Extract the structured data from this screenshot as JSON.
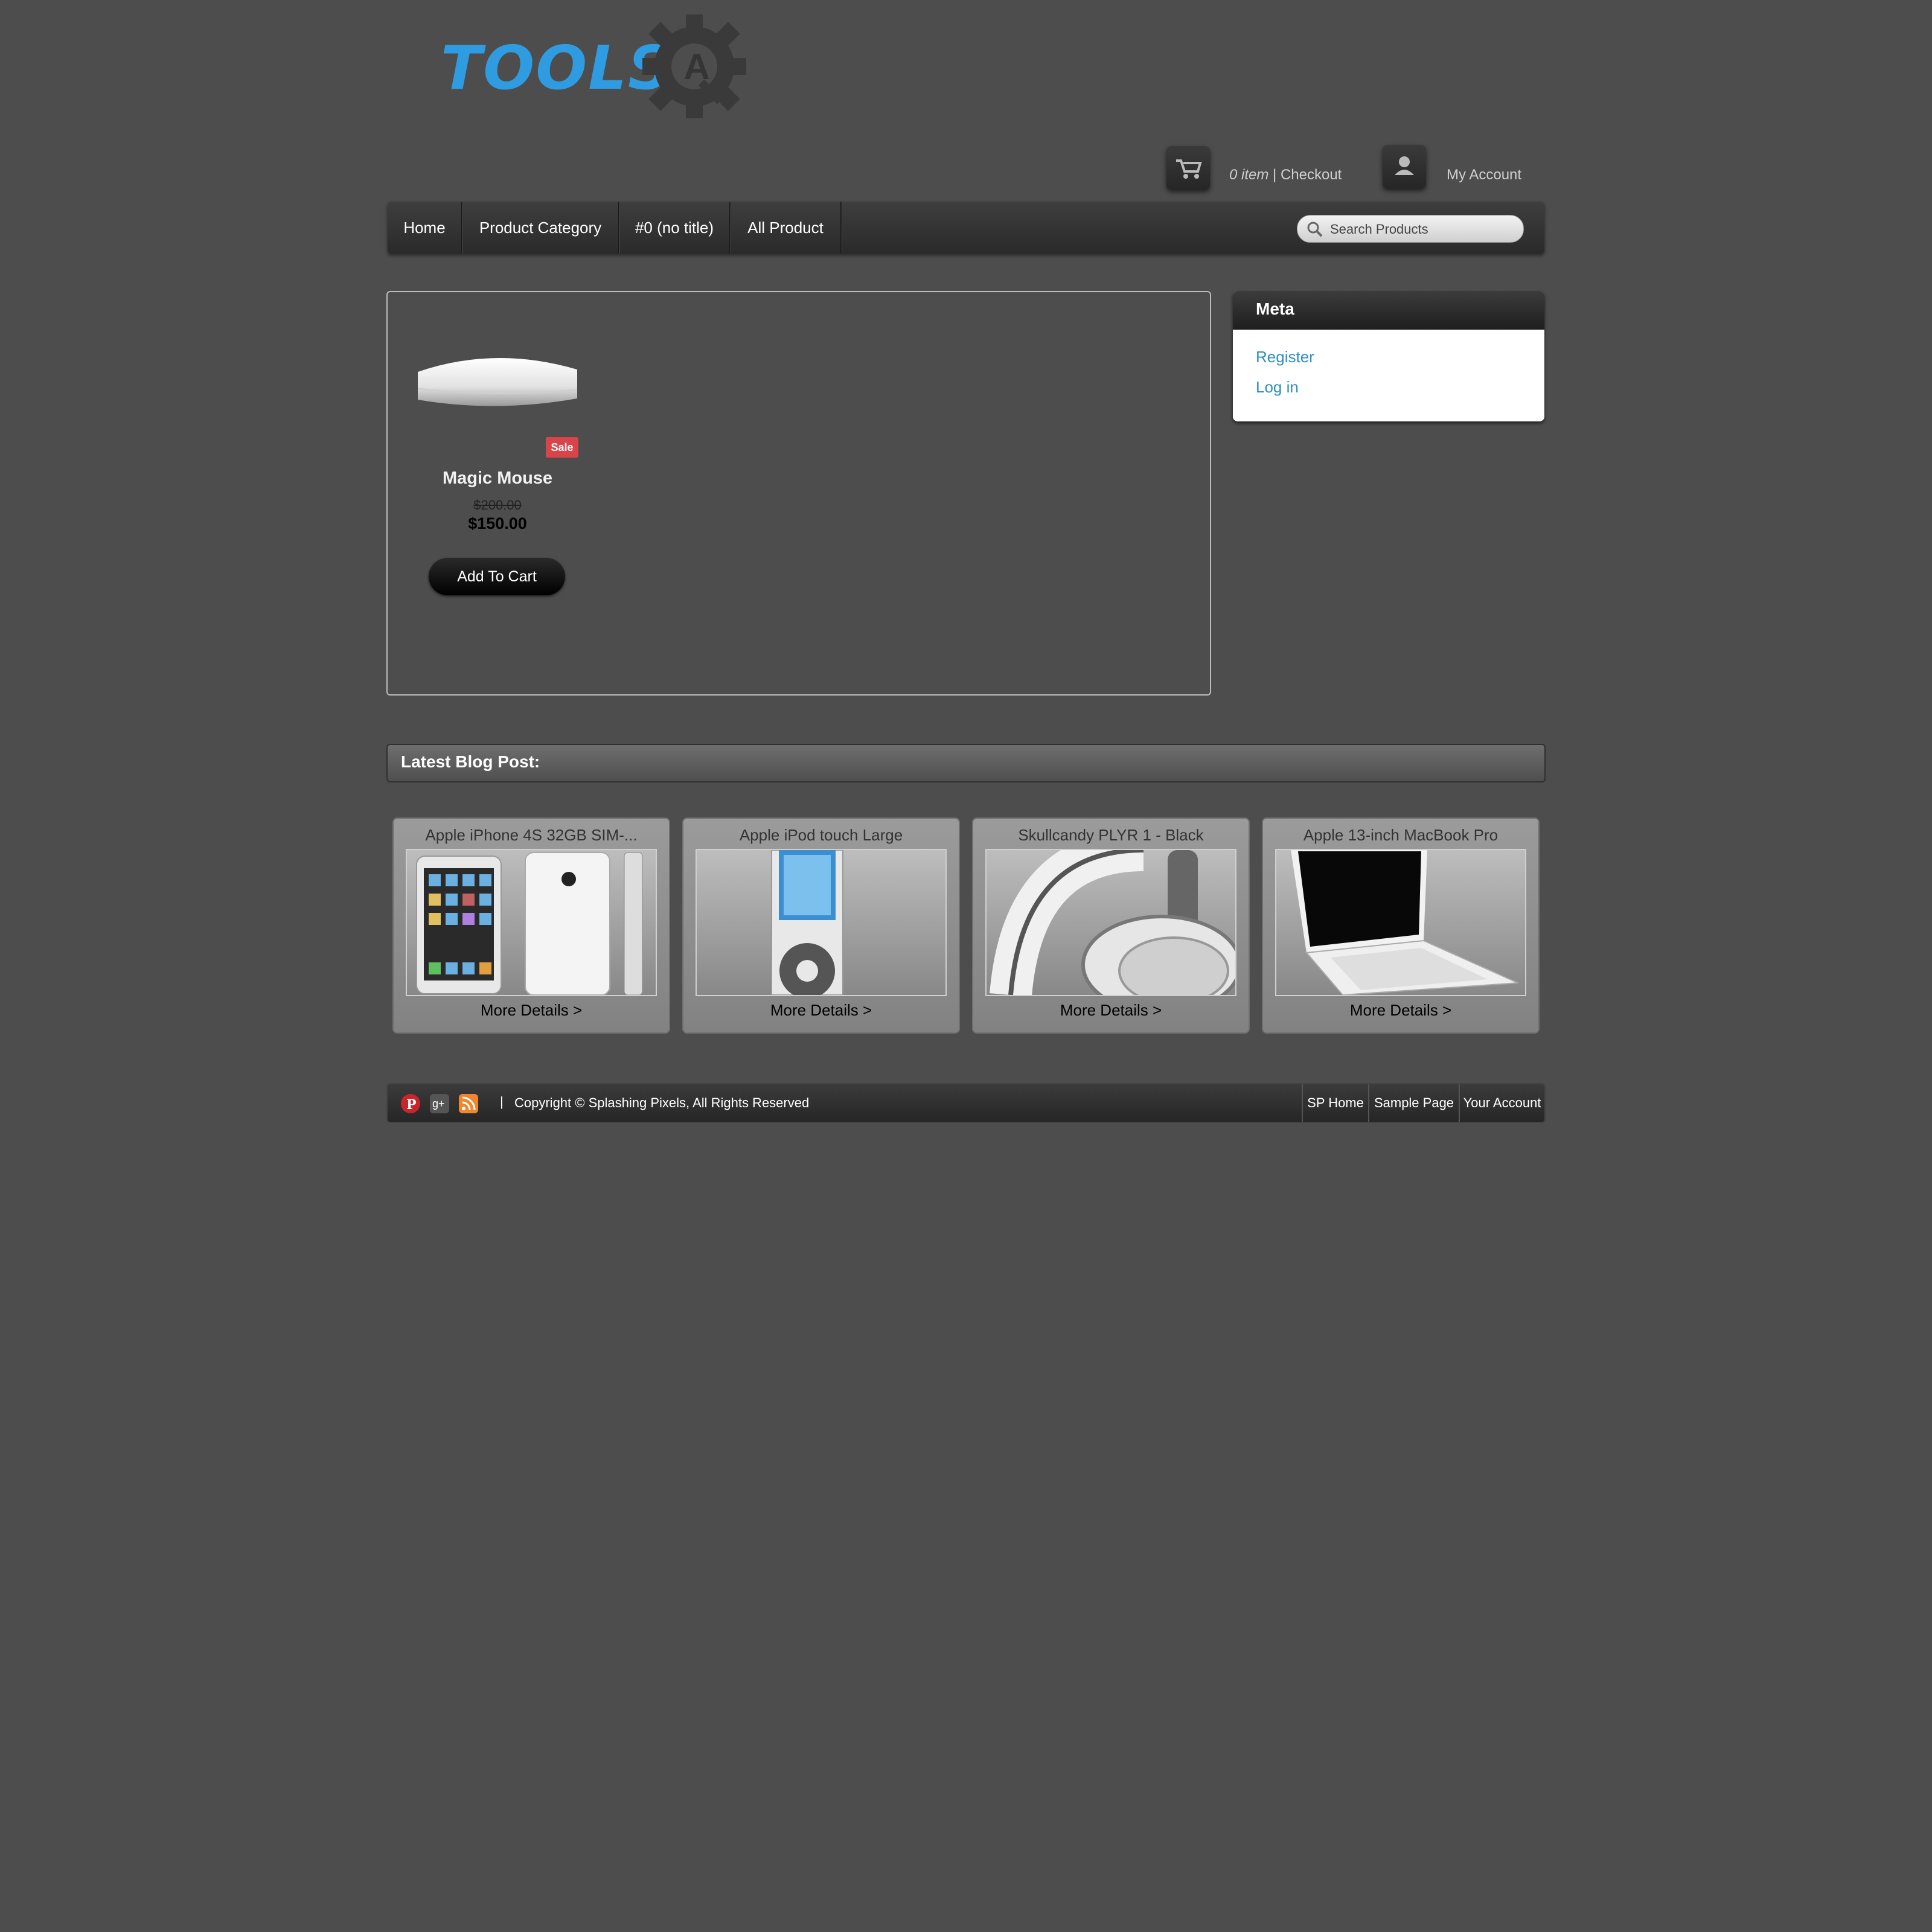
{
  "header": {
    "logo_text": "TOOLS",
    "logo_letter": "A",
    "cart_count": "0 item",
    "cart_separator": " | ",
    "checkout_label": "Checkout",
    "account_label": "My Account"
  },
  "nav": {
    "items": [
      {
        "label": "Home"
      },
      {
        "label": "Product Category"
      },
      {
        "label": "#0 (no title)"
      },
      {
        "label": "All Product"
      }
    ],
    "search_placeholder": "Search Products"
  },
  "product": {
    "title": "Magic Mouse",
    "old_price": "$200.00",
    "new_price": "$150.00",
    "sale_badge": "Sale",
    "add_to_cart": "Add To Cart"
  },
  "meta": {
    "title": "Meta",
    "links": [
      {
        "label": "Register"
      },
      {
        "label": "Log in"
      }
    ]
  },
  "blog": {
    "title": "Latest Blog Post:",
    "cards": [
      {
        "title": "Apple iPhone 4S 32GB SIM-...",
        "more": "More Details >"
      },
      {
        "title": "Apple iPod touch Large",
        "more": "More Details >"
      },
      {
        "title": "Skullcandy PLYR 1 - Black",
        "more": "More Details >"
      },
      {
        "title": "Apple 13-inch MacBook Pro",
        "more": "More Details >"
      }
    ]
  },
  "footer": {
    "separator": "|",
    "copyright": "Copyright © Splashing Pixels, All Rights Reserved",
    "links": [
      {
        "label": "SP Home"
      },
      {
        "label": "Sample Page"
      },
      {
        "label": "Your Account"
      }
    ],
    "social_icons": [
      "pinterest-icon",
      "google-plus-icon",
      "rss-icon"
    ]
  },
  "colors": {
    "background": "#4d4d4d",
    "accent": "#2f9be0",
    "link": "#2d8fc4",
    "sale": "#d9444a"
  }
}
